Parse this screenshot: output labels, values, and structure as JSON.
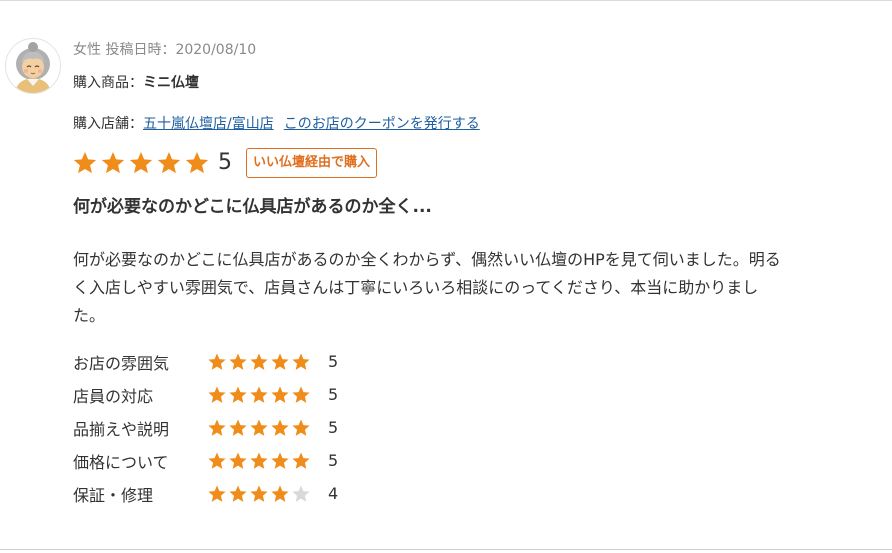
{
  "review": {
    "meta": "女性 投稿日時：2020/08/10",
    "product_label": "購入商品：",
    "product_name": "ミニ仏壇",
    "shop_label": "購入店舗：",
    "shop_name": "五十嵐仏壇店/富山店",
    "coupon_link": "このお店のクーポンを発行する",
    "overall_rating": 5,
    "overall_score_text": "5",
    "badge": "いい仏壇経由で購入",
    "title": "何が必要なのかどこに仏具店があるのか全く...",
    "body": "何が必要なのかどこに仏具店があるのか全くわからず、偶然いい仏壇のHPを見て伺いました。明るく入店しやすい雰囲気で、店員さんは丁寧にいろいろ相談にのってくださり、本当に助かりました。"
  },
  "criteria": [
    {
      "label": "お店の雰囲気",
      "rating": 5,
      "score_text": "5"
    },
    {
      "label": "店員の対応",
      "rating": 5,
      "score_text": "5"
    },
    {
      "label": "品揃えや説明",
      "rating": 5,
      "score_text": "5"
    },
    {
      "label": "価格について",
      "rating": 5,
      "score_text": "5"
    },
    {
      "label": "保証・修理",
      "rating": 4,
      "score_text": "4"
    }
  ],
  "colors": {
    "star_filled": "#f08c1a",
    "star_empty": "#d9d9d9",
    "link": "#1f5fa0",
    "badge": "#e07020"
  },
  "icons": {
    "avatar": "elderly-woman-avatar-icon",
    "star": "star-icon"
  }
}
